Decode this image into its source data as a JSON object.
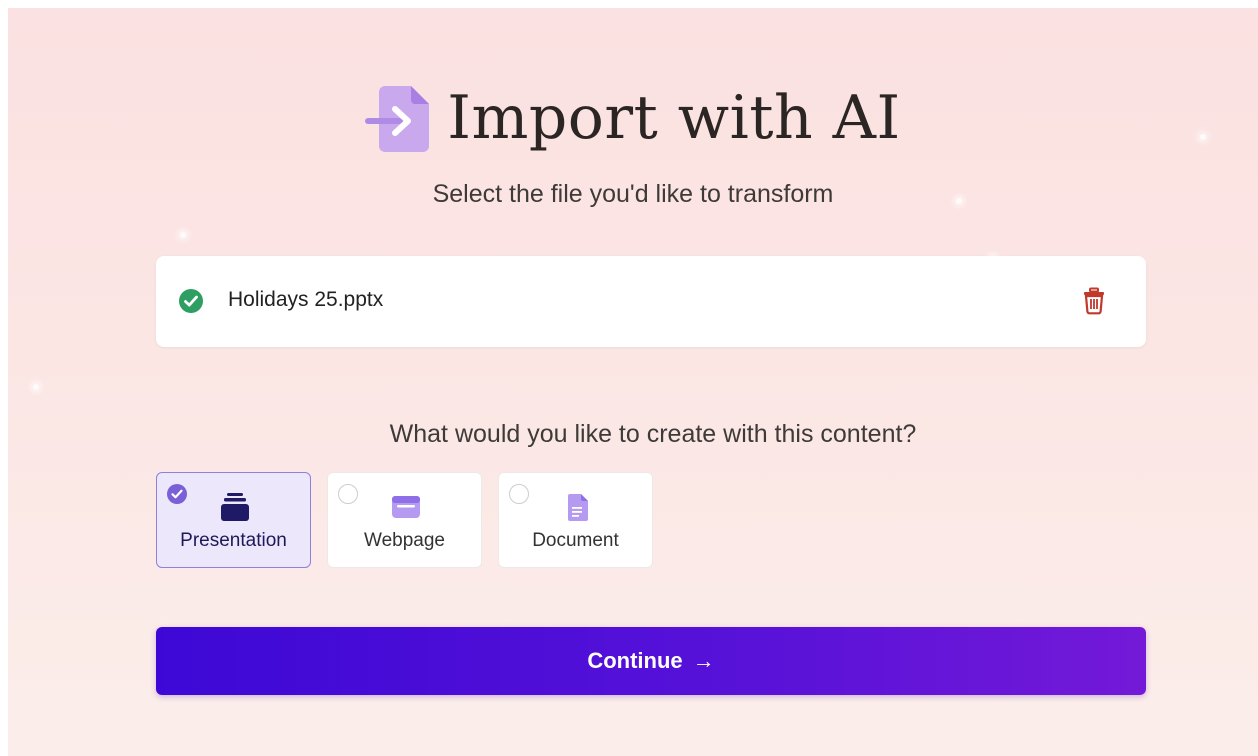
{
  "header": {
    "title": "Import with AI",
    "subtitle": "Select the file you'd like to transform",
    "icon": "import-file-icon"
  },
  "file": {
    "name": "Holidays 25.pptx",
    "status_icon": "check-circle-icon",
    "delete_icon": "trash-icon"
  },
  "create": {
    "question": "What would you like to create with this content?",
    "options": [
      {
        "label": "Presentation",
        "icon": "presentation-icon",
        "selected": true
      },
      {
        "label": "Webpage",
        "icon": "webpage-icon",
        "selected": false
      },
      {
        "label": "Document",
        "icon": "document-icon",
        "selected": false
      }
    ]
  },
  "actions": {
    "continue_label": "Continue",
    "continue_arrow": "→"
  },
  "colors": {
    "accent": "#7b5fd6",
    "button_start": "#3d08d6",
    "button_end": "#7419d8",
    "success": "#2e9e63",
    "danger": "#c0392b"
  }
}
